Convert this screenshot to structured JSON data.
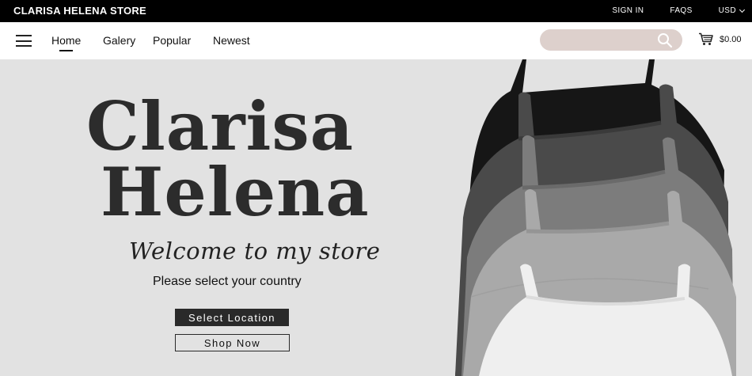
{
  "header": {
    "brand": "CLARISA HELENA STORE",
    "links": {
      "sign_in": "SIGN IN",
      "faqs": "FAQS",
      "currency": "USD"
    }
  },
  "nav": {
    "items": [
      {
        "label": "Home"
      },
      {
        "label": "Galery"
      },
      {
        "label": "Popular"
      },
      {
        "label": "Newest"
      }
    ],
    "search": {
      "placeholder": ""
    },
    "cart_total": "$0.00"
  },
  "hero": {
    "logo_line1": "Clarisa",
    "logo_line2": "Helena",
    "tagline": "Welcome to my store",
    "subline": "Please select your country",
    "select_location_label": "Select Location",
    "shop_now_label": "Shop Now"
  },
  "colors": {
    "topbar": "#000000",
    "hero_bg": "#e2e2e2",
    "search_bg": "#ddd0cc",
    "button_dark": "#2a2a2a"
  },
  "icons": [
    "hamburger-menu-icon",
    "search-icon",
    "cart-icon",
    "chevron-down-icon"
  ]
}
